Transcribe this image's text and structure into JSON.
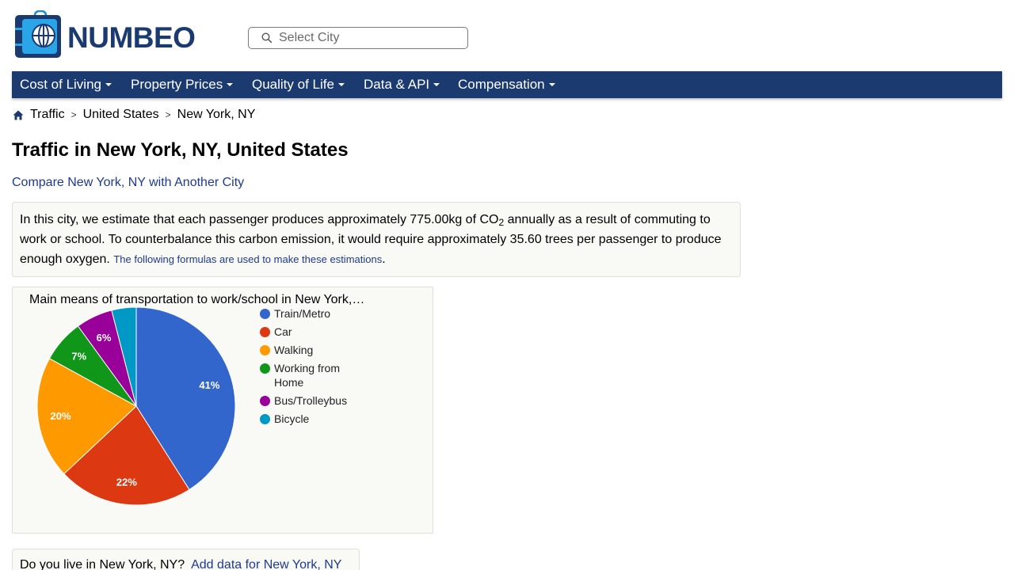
{
  "brand": {
    "name": "NUMBEO",
    "navy": "#1b3a6f",
    "link": "#1d3a8f"
  },
  "search": {
    "placeholder": "Select City",
    "icon": "search-icon"
  },
  "nav": [
    {
      "label": "Cost of Living"
    },
    {
      "label": "Property Prices"
    },
    {
      "label": "Quality of Life"
    },
    {
      "label": "Data & API"
    },
    {
      "label": "Compensation"
    }
  ],
  "breadcrumb": {
    "home_icon": "home-icon",
    "items": [
      "Traffic",
      "United States",
      "New York, NY"
    ],
    "separator": ">"
  },
  "page": {
    "title": "Traffic in New York, NY, United States",
    "compare_link": "Compare New York, NY with Another City"
  },
  "info": {
    "part1": "In this city, we estimate that each passenger produces approximately 775.00kg of CO",
    "sub": "2",
    "part2": " annually as a result of commuting to work or school. To counterbalance this carbon emission, it would require approximately 35.60 trees per passenger to produce enough oxygen. ",
    "formulas_link": "The following formulas are used to make these estimations",
    "end": "."
  },
  "chart_data": {
    "type": "pie",
    "title": "Main means of transportation to work/school in New York,…",
    "slices": [
      {
        "label": "Train/Metro",
        "value": 41,
        "color": "#3366cc",
        "data_label": "41%"
      },
      {
        "label": "Car",
        "value": 22,
        "color": "#dc3912",
        "data_label": "22%"
      },
      {
        "label": "Walking",
        "value": 20,
        "color": "#ff9900",
        "data_label": "20%"
      },
      {
        "label": "Working from Home",
        "value": 7,
        "color": "#109618",
        "data_label": "7%"
      },
      {
        "label": "Bus/Trolleybus",
        "value": 6,
        "color": "#990099",
        "data_label": "6%"
      },
      {
        "label": "Bicycle",
        "value": 4,
        "color": "#0099c6",
        "data_label": ""
      }
    ],
    "legend_position": "right"
  },
  "live": {
    "question": "Do you live in New York, NY?",
    "add_link": "Add data for New York, NY"
  }
}
